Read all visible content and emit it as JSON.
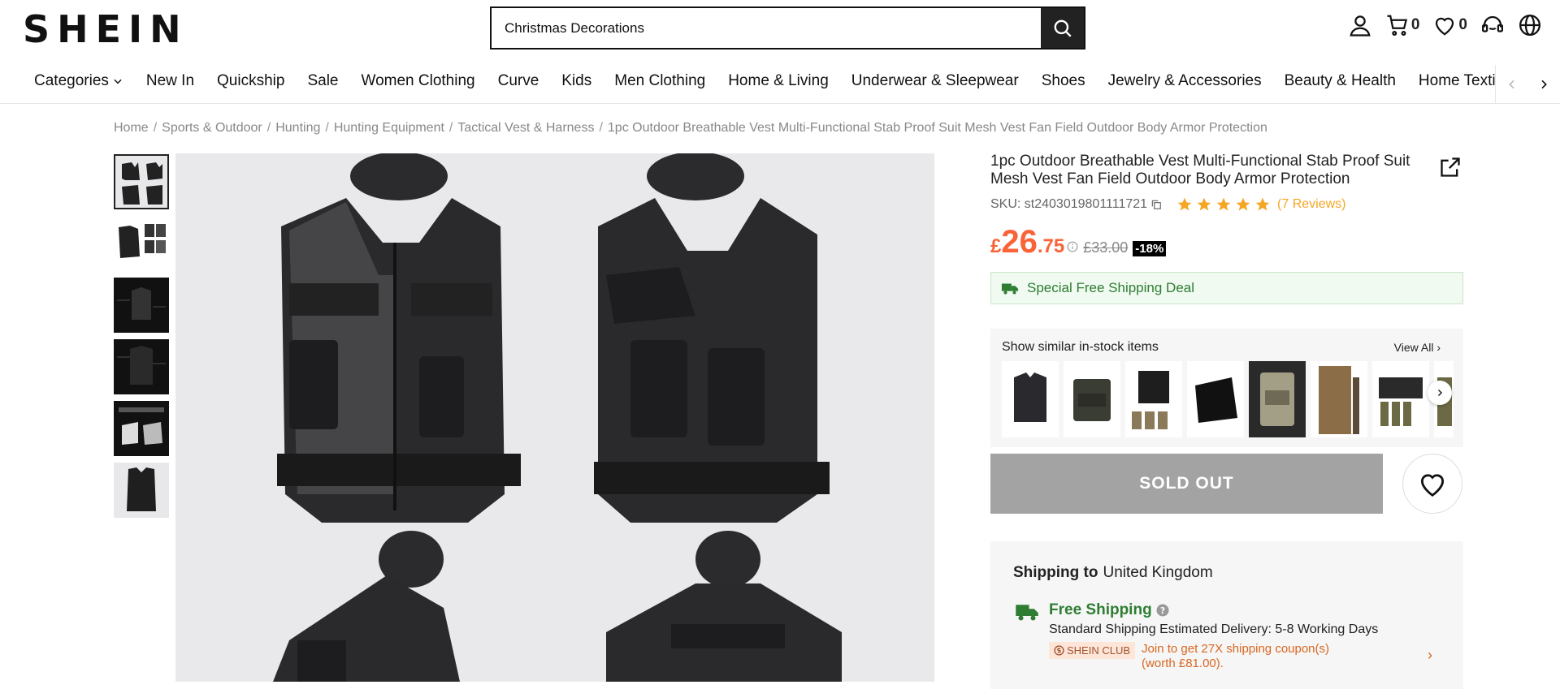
{
  "header": {
    "logo": "SHEIN",
    "search": {
      "value": "Christmas Decorations"
    },
    "cart_count": "0",
    "wishlist_count": "0"
  },
  "nav": {
    "items": [
      "Categories",
      "New In",
      "Quickship",
      "Sale",
      "Women Clothing",
      "Curve",
      "Kids",
      "Men Clothing",
      "Home & Living",
      "Underwear & Sleepwear",
      "Shoes",
      "Jewelry & Accessories",
      "Beauty & Health",
      "Home Textiles"
    ]
  },
  "breadcrumb": [
    "Home",
    "Sports & Outdoor",
    "Hunting",
    "Hunting Equipment",
    "Tactical Vest & Harness",
    "1pc Outdoor Breathable Vest Multi-Functional Stab Proof Suit Mesh Vest Fan Field Outdoor Body Armor Protection"
  ],
  "product": {
    "title": "1pc Outdoor Breathable Vest Multi-Functional Stab Proof Suit Mesh Vest Fan Field Outdoor Body Armor Protection",
    "sku_label": "SKU: st2403019801111721",
    "rating": 5,
    "reviews": "(7 Reviews)",
    "price_currency": "£",
    "price_int": "26",
    "price_dec": ".75",
    "price_old": "£33.00",
    "discount": "-18%",
    "shipping_deal": "Special Free Shipping Deal",
    "similar_label": "Show similar in-stock items",
    "view_all": "View All",
    "sold_out": "SOLD OUT"
  },
  "shipping": {
    "to_label": "Shipping to",
    "country": "United Kingdom",
    "free": "Free Shipping",
    "estimate": "Standard Shipping Estimated Delivery: 5-8 Working Days",
    "club_badge": "SHEIN CLUB",
    "club_text": "Join to get 27X shipping coupon(s) (worth £81.00)."
  },
  "colors": {
    "accent": "#fa6338",
    "green": "#2e7d32",
    "star": "#f5a623"
  }
}
